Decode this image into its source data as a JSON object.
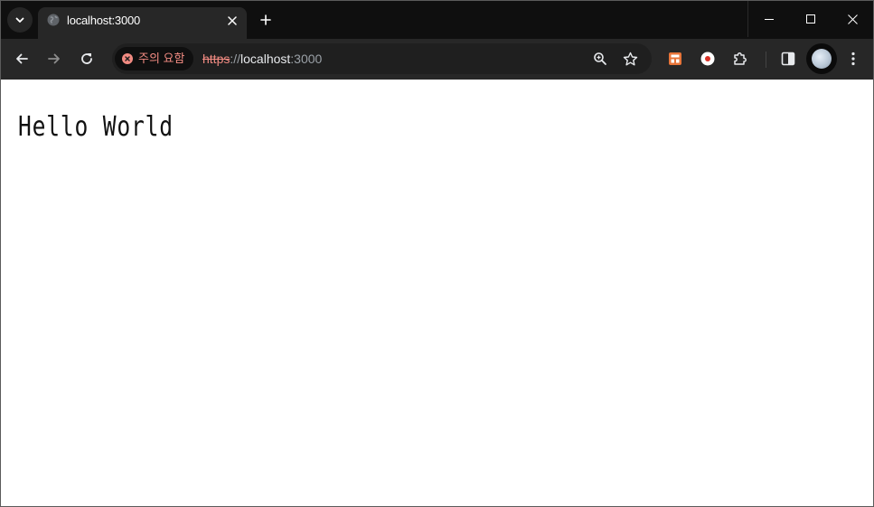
{
  "browser": {
    "tab": {
      "title": "localhost:3000",
      "favicon": "globe-icon"
    },
    "window_controls": [
      "minimize-icon",
      "maximize-icon",
      "close-icon"
    ]
  },
  "toolbar": {
    "security": {
      "warning_text": "주의 요함",
      "icon": "warning-circle-icon",
      "color": "#f28b82"
    },
    "url": {
      "scheme": "https",
      "separator": "://",
      "host": "localhost",
      "port": ":3000"
    },
    "icons": [
      "back-icon",
      "forward-icon",
      "reload-icon",
      "zoom-icon",
      "bookmark-star-icon",
      "extension-orange-icon",
      "extension-record-icon",
      "extensions-puzzle-icon",
      "side-panel-icon",
      "avatar",
      "menu-kebab-icon"
    ]
  },
  "page": {
    "heading": "Hello World"
  },
  "colors": {
    "titlebar": "#0f0f0f",
    "toolbar": "#272727",
    "omnibox": "#1f1f1f",
    "page_background": "#ffffff"
  }
}
